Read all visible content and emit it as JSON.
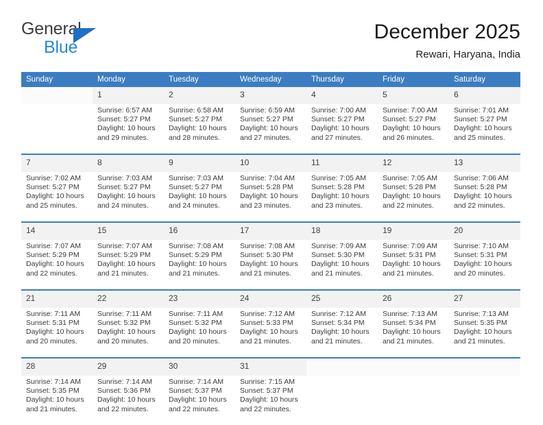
{
  "brand": {
    "name_top": "General",
    "name_bottom": "Blue",
    "accent_color": "#2389d6",
    "triangle_color": "#1f6fc4"
  },
  "header": {
    "title": "December 2025",
    "location": "Rewari, Haryana, India"
  },
  "theme": {
    "header_row_bg": "#3b7dc0",
    "daynum_bg": "#f2f2f2",
    "text_color": "#3a3a3a"
  },
  "weekdays": [
    "Sunday",
    "Monday",
    "Tuesday",
    "Wednesday",
    "Thursday",
    "Friday",
    "Saturday"
  ],
  "weeks": [
    {
      "days": [
        {
          "num": "",
          "sunrise": "",
          "sunset": "",
          "daylight": ""
        },
        {
          "num": "1",
          "sunrise": "Sunrise: 6:57 AM",
          "sunset": "Sunset: 5:27 PM",
          "daylight": "Daylight: 10 hours and 29 minutes."
        },
        {
          "num": "2",
          "sunrise": "Sunrise: 6:58 AM",
          "sunset": "Sunset: 5:27 PM",
          "daylight": "Daylight: 10 hours and 28 minutes."
        },
        {
          "num": "3",
          "sunrise": "Sunrise: 6:59 AM",
          "sunset": "Sunset: 5:27 PM",
          "daylight": "Daylight: 10 hours and 27 minutes."
        },
        {
          "num": "4",
          "sunrise": "Sunrise: 7:00 AM",
          "sunset": "Sunset: 5:27 PM",
          "daylight": "Daylight: 10 hours and 27 minutes."
        },
        {
          "num": "5",
          "sunrise": "Sunrise: 7:00 AM",
          "sunset": "Sunset: 5:27 PM",
          "daylight": "Daylight: 10 hours and 26 minutes."
        },
        {
          "num": "6",
          "sunrise": "Sunrise: 7:01 AM",
          "sunset": "Sunset: 5:27 PM",
          "daylight": "Daylight: 10 hours and 25 minutes."
        }
      ]
    },
    {
      "days": [
        {
          "num": "7",
          "sunrise": "Sunrise: 7:02 AM",
          "sunset": "Sunset: 5:27 PM",
          "daylight": "Daylight: 10 hours and 25 minutes."
        },
        {
          "num": "8",
          "sunrise": "Sunrise: 7:03 AM",
          "sunset": "Sunset: 5:27 PM",
          "daylight": "Daylight: 10 hours and 24 minutes."
        },
        {
          "num": "9",
          "sunrise": "Sunrise: 7:03 AM",
          "sunset": "Sunset: 5:27 PM",
          "daylight": "Daylight: 10 hours and 24 minutes."
        },
        {
          "num": "10",
          "sunrise": "Sunrise: 7:04 AM",
          "sunset": "Sunset: 5:28 PM",
          "daylight": "Daylight: 10 hours and 23 minutes."
        },
        {
          "num": "11",
          "sunrise": "Sunrise: 7:05 AM",
          "sunset": "Sunset: 5:28 PM",
          "daylight": "Daylight: 10 hours and 23 minutes."
        },
        {
          "num": "12",
          "sunrise": "Sunrise: 7:05 AM",
          "sunset": "Sunset: 5:28 PM",
          "daylight": "Daylight: 10 hours and 22 minutes."
        },
        {
          "num": "13",
          "sunrise": "Sunrise: 7:06 AM",
          "sunset": "Sunset: 5:28 PM",
          "daylight": "Daylight: 10 hours and 22 minutes."
        }
      ]
    },
    {
      "days": [
        {
          "num": "14",
          "sunrise": "Sunrise: 7:07 AM",
          "sunset": "Sunset: 5:29 PM",
          "daylight": "Daylight: 10 hours and 22 minutes."
        },
        {
          "num": "15",
          "sunrise": "Sunrise: 7:07 AM",
          "sunset": "Sunset: 5:29 PM",
          "daylight": "Daylight: 10 hours and 21 minutes."
        },
        {
          "num": "16",
          "sunrise": "Sunrise: 7:08 AM",
          "sunset": "Sunset: 5:29 PM",
          "daylight": "Daylight: 10 hours and 21 minutes."
        },
        {
          "num": "17",
          "sunrise": "Sunrise: 7:08 AM",
          "sunset": "Sunset: 5:30 PM",
          "daylight": "Daylight: 10 hours and 21 minutes."
        },
        {
          "num": "18",
          "sunrise": "Sunrise: 7:09 AM",
          "sunset": "Sunset: 5:30 PM",
          "daylight": "Daylight: 10 hours and 21 minutes."
        },
        {
          "num": "19",
          "sunrise": "Sunrise: 7:09 AM",
          "sunset": "Sunset: 5:31 PM",
          "daylight": "Daylight: 10 hours and 21 minutes."
        },
        {
          "num": "20",
          "sunrise": "Sunrise: 7:10 AM",
          "sunset": "Sunset: 5:31 PM",
          "daylight": "Daylight: 10 hours and 20 minutes."
        }
      ]
    },
    {
      "days": [
        {
          "num": "21",
          "sunrise": "Sunrise: 7:11 AM",
          "sunset": "Sunset: 5:31 PM",
          "daylight": "Daylight: 10 hours and 20 minutes."
        },
        {
          "num": "22",
          "sunrise": "Sunrise: 7:11 AM",
          "sunset": "Sunset: 5:32 PM",
          "daylight": "Daylight: 10 hours and 20 minutes."
        },
        {
          "num": "23",
          "sunrise": "Sunrise: 7:11 AM",
          "sunset": "Sunset: 5:32 PM",
          "daylight": "Daylight: 10 hours and 20 minutes."
        },
        {
          "num": "24",
          "sunrise": "Sunrise: 7:12 AM",
          "sunset": "Sunset: 5:33 PM",
          "daylight": "Daylight: 10 hours and 21 minutes."
        },
        {
          "num": "25",
          "sunrise": "Sunrise: 7:12 AM",
          "sunset": "Sunset: 5:34 PM",
          "daylight": "Daylight: 10 hours and 21 minutes."
        },
        {
          "num": "26",
          "sunrise": "Sunrise: 7:13 AM",
          "sunset": "Sunset: 5:34 PM",
          "daylight": "Daylight: 10 hours and 21 minutes."
        },
        {
          "num": "27",
          "sunrise": "Sunrise: 7:13 AM",
          "sunset": "Sunset: 5:35 PM",
          "daylight": "Daylight: 10 hours and 21 minutes."
        }
      ]
    },
    {
      "days": [
        {
          "num": "28",
          "sunrise": "Sunrise: 7:14 AM",
          "sunset": "Sunset: 5:35 PM",
          "daylight": "Daylight: 10 hours and 21 minutes."
        },
        {
          "num": "29",
          "sunrise": "Sunrise: 7:14 AM",
          "sunset": "Sunset: 5:36 PM",
          "daylight": "Daylight: 10 hours and 22 minutes."
        },
        {
          "num": "30",
          "sunrise": "Sunrise: 7:14 AM",
          "sunset": "Sunset: 5:37 PM",
          "daylight": "Daylight: 10 hours and 22 minutes."
        },
        {
          "num": "31",
          "sunrise": "Sunrise: 7:15 AM",
          "sunset": "Sunset: 5:37 PM",
          "daylight": "Daylight: 10 hours and 22 minutes."
        },
        {
          "num": "",
          "sunrise": "",
          "sunset": "",
          "daylight": ""
        },
        {
          "num": "",
          "sunrise": "",
          "sunset": "",
          "daylight": ""
        },
        {
          "num": "",
          "sunrise": "",
          "sunset": "",
          "daylight": ""
        }
      ]
    }
  ]
}
